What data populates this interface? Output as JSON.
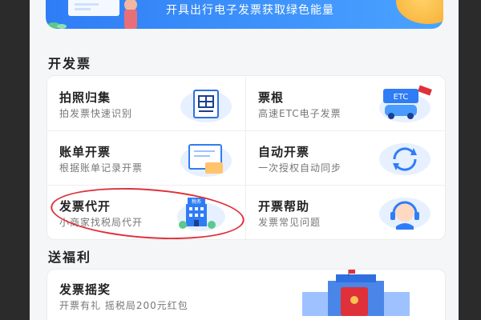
{
  "banner": {
    "text": "开具出行电子发票获取绿色能量"
  },
  "invoice_section": {
    "title": "开发票",
    "tiles": [
      {
        "title": "拍照归集",
        "subtitle": "拍发票快速识别",
        "icon": "receipt-scan-icon"
      },
      {
        "title": "票根",
        "subtitle": "高速ETC电子发票",
        "icon": "etc-car-icon",
        "icon_text": "ETC"
      },
      {
        "title": "账单开票",
        "subtitle": "根据账单记录开票",
        "icon": "bill-invoice-icon"
      },
      {
        "title": "自动开票",
        "subtitle": "一次授权自动同步",
        "icon": "auto-sync-icon"
      },
      {
        "title": "发票代开",
        "subtitle": "小商家找税局代开",
        "icon": "tax-bureau-icon",
        "icon_text": "税务",
        "highlighted": true
      },
      {
        "title": "开票帮助",
        "subtitle": "发票常见问题",
        "icon": "headset-help-icon"
      }
    ]
  },
  "welfare_section": {
    "title": "送福利",
    "item": {
      "title": "发票摇奖",
      "subtitle": "开票有礼 摇税局200元红包",
      "icon": "red-envelope-icon"
    }
  },
  "colors": {
    "accent": "#2f7df6",
    "highlight": "#e0303a",
    "coin": "#f5a623"
  }
}
